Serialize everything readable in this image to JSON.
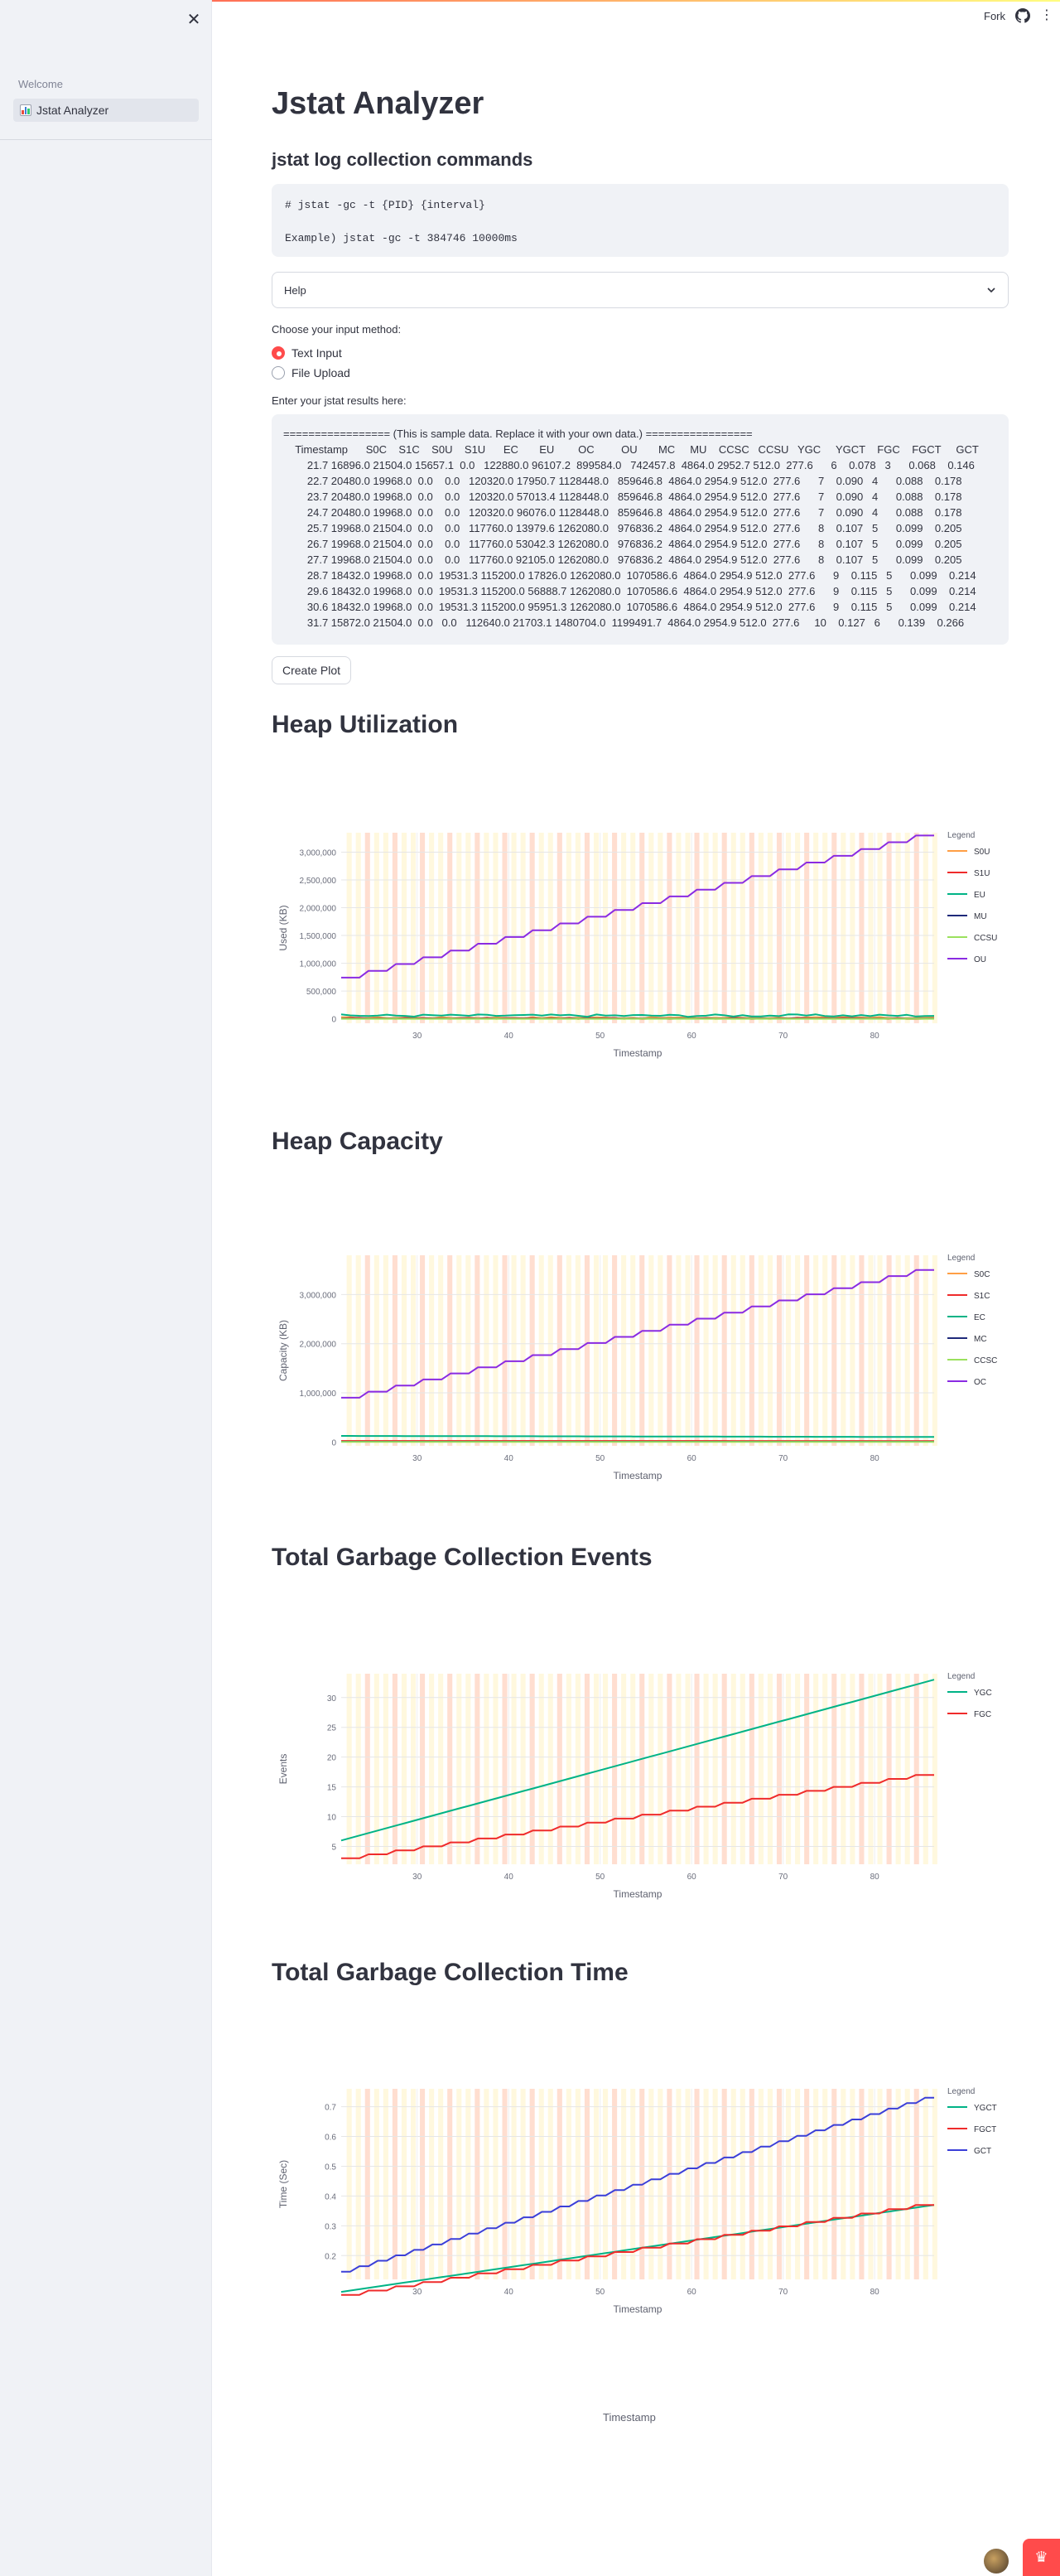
{
  "app": {
    "title": "Jstat Analyzer",
    "accent": "#ff4b4b"
  },
  "sidebar": {
    "heading": "Welcome",
    "items": [
      {
        "label": "Jstat Analyzer",
        "icon": "bar-chart-icon",
        "active": true
      }
    ],
    "close_icon": "close-icon"
  },
  "header": {
    "fork_label": "Fork",
    "github_icon": "github-icon",
    "menu_icon": "kebab-menu-icon"
  },
  "main": {
    "title": "Jstat Analyzer",
    "commands_heading": "jstat log collection commands",
    "code_lines": [
      "# jstat -gc -t {PID} {interval}",
      "Example) jstat -gc -t 384746 10000ms"
    ],
    "help_label": "Help",
    "input_method_label": "Choose your input method:",
    "input_methods": [
      {
        "label": "Text Input",
        "selected": true
      },
      {
        "label": "File Upload",
        "selected": false
      }
    ],
    "textarea_label": "Enter your jstat results here:",
    "textarea_lines": [
      "================= (This is sample data. Replace it with your own data.) =================",
      "    Timestamp      S0C    S1C    S0U    S1U      EC       EU        OC         OU       MC     MU    CCSC   CCSU   YGC     YGCT    FGC    FGCT     GCT",
      "        21.7 16896.0 21504.0 15657.1  0.0   122880.0 96107.2  899584.0   742457.8  4864.0 2952.7 512.0  277.6      6    0.078   3      0.068    0.146",
      "        22.7 20480.0 19968.0  0.0    0.0   120320.0 17950.7 1128448.0   859646.8  4864.0 2954.9 512.0  277.6      7    0.090   4      0.088    0.178",
      "        23.7 20480.0 19968.0  0.0    0.0   120320.0 57013.4 1128448.0   859646.8  4864.0 2954.9 512.0  277.6      7    0.090   4      0.088    0.178",
      "        24.7 20480.0 19968.0  0.0    0.0   120320.0 96076.0 1128448.0   859646.8  4864.0 2954.9 512.0  277.6      7    0.090   4      0.088    0.178",
      "        25.7 19968.0 21504.0  0.0    0.0   117760.0 13979.6 1262080.0   976836.2  4864.0 2954.9 512.0  277.6      8    0.107   5      0.099    0.205",
      "        26.7 19968.0 21504.0  0.0    0.0   117760.0 53042.3 1262080.0   976836.2  4864.0 2954.9 512.0  277.6      8    0.107   5      0.099    0.205",
      "        27.7 19968.0 21504.0  0.0    0.0   117760.0 92105.0 1262080.0   976836.2  4864.0 2954.9 512.0  277.6      8    0.107   5      0.099    0.205",
      "        28.7 18432.0 19968.0  0.0  19531.3 115200.0 17826.0 1262080.0  1070586.6  4864.0 2954.9 512.0  277.6      9    0.115   5      0.099    0.214",
      "        29.6 18432.0 19968.0  0.0  19531.3 115200.0 56888.7 1262080.0  1070586.6  4864.0 2954.9 512.0  277.6      9    0.115   5      0.099    0.214",
      "        30.6 18432.0 19968.0  0.0  19531.3 115200.0 95951.3 1262080.0  1070586.6  4864.0 2954.9 512.0  277.6      9    0.115   5      0.099    0.214",
      "        31.7 15872.0 21504.0  0.0   0.0   112640.0 21703.1 1480704.0  1199491.7  4864.0 2954.9 512.0  277.6     10    0.127   6      0.139    0.266"
    ],
    "create_plot_label": "Create Plot",
    "bottom_xlabel": "Timestamp"
  },
  "chart_data": [
    {
      "type": "line",
      "title": "Heap Utilization",
      "xlabel": "Timestamp",
      "ylabel": "Used (KB)",
      "xlim": [
        21.7,
        86.5
      ],
      "ylim": [
        -80000,
        3350000
      ],
      "xticks": [
        30,
        40,
        50,
        60,
        70,
        80
      ],
      "yticks": [
        0,
        500000,
        1000000,
        1500000,
        2000000,
        2500000,
        3000000
      ],
      "ytick_labels": [
        "0",
        "500,000",
        "1,000,000",
        "1,500,000",
        "2,000,000",
        "2,500,000",
        "3,000,000"
      ],
      "grid": true,
      "legend": {
        "title": "Legend",
        "placement": "right"
      },
      "series": [
        {
          "name": "S0U",
          "color": "#ff9f45",
          "step": 3,
          "y0": 15000,
          "y1": 15000,
          "jitter": 25000
        },
        {
          "name": "S1U",
          "color": "#ef2b2b",
          "step": 3,
          "y0": 5000,
          "y1": 5000,
          "jitter": 20000
        },
        {
          "name": "EU",
          "color": "#00b386",
          "step": 3,
          "y0": 50000,
          "y1": 50000,
          "jitter": 45000
        },
        {
          "name": "MU",
          "color": "#1f2a7a",
          "step": 0,
          "y0": 2955,
          "y1": 2955,
          "jitter": 0
        },
        {
          "name": "CCSU",
          "color": "#9be15d",
          "step": 0,
          "y0": 278,
          "y1": 278,
          "jitter": 0
        },
        {
          "name": "OU",
          "color": "#8a2be2",
          "step": 3,
          "y0": 742000,
          "y1": 3300000,
          "jitter": 0
        }
      ]
    },
    {
      "type": "line",
      "title": "Heap Capacity",
      "xlabel": "Timestamp",
      "ylabel": "Capacity (KB)",
      "xlim": [
        21.7,
        86.5
      ],
      "ylim": [
        -80000,
        3800000
      ],
      "xticks": [
        30,
        40,
        50,
        60,
        70,
        80
      ],
      "yticks": [
        0,
        1000000,
        2000000,
        3000000
      ],
      "ytick_labels": [
        "0",
        "1,000,000",
        "2,000,000",
        "3,000,000"
      ],
      "grid": true,
      "legend": {
        "title": "Legend",
        "placement": "right"
      },
      "series": [
        {
          "name": "S0C",
          "color": "#ff9f45",
          "step": 0,
          "y0": 18000,
          "y1": 15000,
          "jitter": 0
        },
        {
          "name": "S1C",
          "color": "#ef2b2b",
          "step": 0,
          "y0": 20000,
          "y1": 18000,
          "jitter": 0
        },
        {
          "name": "EC",
          "color": "#00b386",
          "step": 0,
          "y0": 122000,
          "y1": 100000,
          "jitter": 0
        },
        {
          "name": "MC",
          "color": "#1f2a7a",
          "step": 0,
          "y0": 4864,
          "y1": 4864,
          "jitter": 0
        },
        {
          "name": "CCSC",
          "color": "#9be15d",
          "step": 0,
          "y0": 512,
          "y1": 512,
          "jitter": 0
        },
        {
          "name": "OC",
          "color": "#8a2be2",
          "step": 3,
          "y0": 900000,
          "y1": 3500000,
          "jitter": 0
        }
      ]
    },
    {
      "type": "line",
      "title": "Total Garbage Collection Events",
      "xlabel": "Timestamp",
      "ylabel": "Events",
      "xlim": [
        21.7,
        86.5
      ],
      "ylim": [
        2,
        34
      ],
      "xticks": [
        30,
        40,
        50,
        60,
        70,
        80
      ],
      "yticks": [
        5,
        10,
        15,
        20,
        25,
        30
      ],
      "ytick_labels": [
        "5",
        "10",
        "15",
        "20",
        "25",
        "30"
      ],
      "grid": true,
      "legend": {
        "title": "Legend",
        "placement": "right"
      },
      "series": [
        {
          "name": "YGC",
          "color": "#00b386",
          "step": 1,
          "y0": 6,
          "y1": 33,
          "jitter": 0
        },
        {
          "name": "FGC",
          "color": "#ef2b2b",
          "step": 3,
          "y0": 3,
          "y1": 17,
          "jitter": 0
        }
      ]
    },
    {
      "type": "line",
      "title": "Total Garbage Collection Time",
      "xlabel": "Timestamp",
      "ylabel": "Time (Sec)",
      "xlim": [
        21.7,
        86.5
      ],
      "ylim": [
        0.12,
        0.76
      ],
      "xticks": [
        30,
        40,
        50,
        60,
        70,
        80
      ],
      "yticks": [
        0.2,
        0.3,
        0.4,
        0.5,
        0.6,
        0.7
      ],
      "ytick_labels": [
        "0.2",
        "0.3",
        "0.4",
        "0.5",
        "0.6",
        "0.7"
      ],
      "grid": true,
      "legend": {
        "title": "Legend",
        "placement": "right"
      },
      "series": [
        {
          "name": "YGCT",
          "color": "#00b386",
          "step": 1,
          "y0": 0.078,
          "y1": 0.37,
          "jitter": 0
        },
        {
          "name": "FGCT",
          "color": "#ef2b2b",
          "step": 3,
          "y0": 0.068,
          "y1": 0.37,
          "jitter": 0
        },
        {
          "name": "GCT",
          "color": "#3b3fd8",
          "step": 2,
          "y0": 0.146,
          "y1": 0.73,
          "jitter": 0
        }
      ]
    }
  ]
}
